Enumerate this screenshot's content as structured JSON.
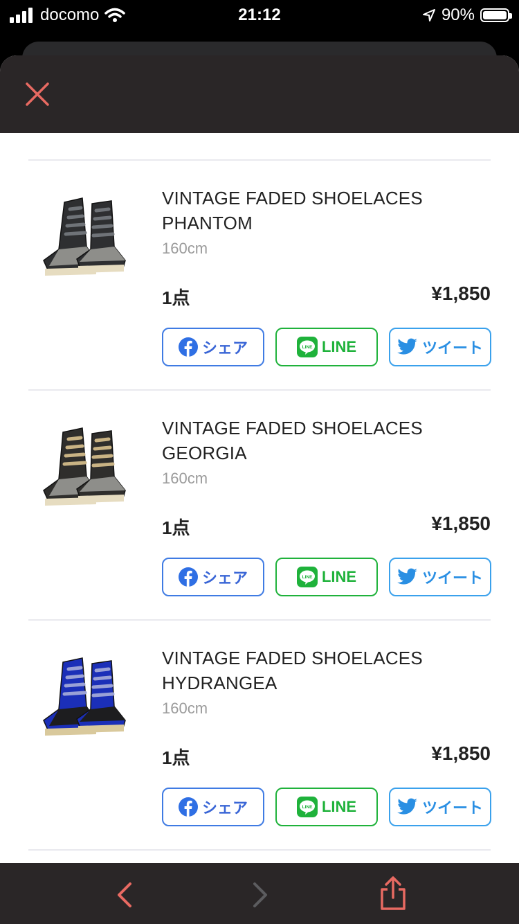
{
  "status_bar": {
    "carrier": "docomo",
    "time": "21:12",
    "battery": "90%"
  },
  "items": [
    {
      "title_line1": "VINTAGE FADED SHOELACES",
      "title_line2": "PHANTOM",
      "size": "160cm",
      "quantity": "1点",
      "price": "¥1,850",
      "lace_color": "#6f7378",
      "upper_color": "#2e2f31"
    },
    {
      "title_line1": "VINTAGE FADED SHOELACES",
      "title_line2": "GEORGIA",
      "size": "160cm",
      "quantity": "1点",
      "price": "¥1,850",
      "lace_color": "#c9b384",
      "upper_color": "#2f2e2c"
    },
    {
      "title_line1": "VINTAGE FADED SHOELACES",
      "title_line2": "HYDRANGEA",
      "size": "160cm",
      "quantity": "1点",
      "price": "¥1,850",
      "lace_color": "#9aa1d6",
      "upper_color": "#1b2fb8"
    }
  ],
  "share": {
    "facebook_label": "シェア",
    "line_label": "LINE",
    "twitter_label": "ツイート"
  },
  "colors": {
    "close": "#e86a62",
    "back_arrow": "#e86a62",
    "forward_arrow": "#5c5c5f",
    "share": "#e86a62"
  }
}
